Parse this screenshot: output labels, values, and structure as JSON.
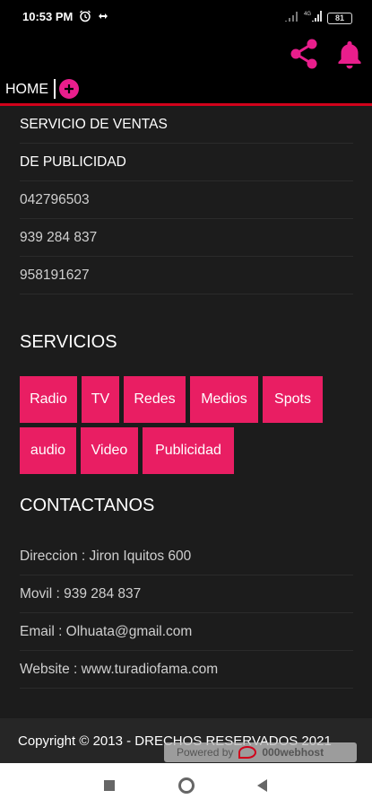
{
  "status_bar": {
    "time": "10:53 PM",
    "battery": "81",
    "icons": [
      "alarm-icon",
      "wifi-direct-icon",
      "signal-icon",
      "signal-4g-icon",
      "battery-icon"
    ]
  },
  "header": {
    "home_label": "HOME",
    "share_icon": "share-icon",
    "bell_icon": "bell-icon",
    "plus_icon": "plus-icon",
    "accent_color": "#e91e8c",
    "divider_color": "#d0021b"
  },
  "info": {
    "items": [
      "SERVICIO DE VENTAS",
      "DE PUBLICIDAD",
      "042796503",
      "939 284 837",
      "958191627"
    ]
  },
  "services": {
    "title": "SERVICIOS",
    "tags": [
      "Radio",
      "TV",
      "Redes",
      "Medios",
      "Spots",
      "audio",
      "Video",
      "Publicidad"
    ],
    "tag_color": "#e91e63"
  },
  "contact": {
    "title": "CONTACTANOS",
    "items": [
      "Direccion : Jiron Iquitos 600",
      "Movil : 939 284 837",
      "Email : Olhuata@gmail.com",
      "Website : www.turadiofama.com"
    ]
  },
  "footer": {
    "copyright": "Copyright © 2013 - DRECHOS RESERVADOS 2021",
    "powered_by": "Powered by",
    "powered_brand": "000webhost"
  },
  "nav_bar": {
    "icons": [
      "recents-icon",
      "home-icon",
      "back-icon"
    ]
  }
}
